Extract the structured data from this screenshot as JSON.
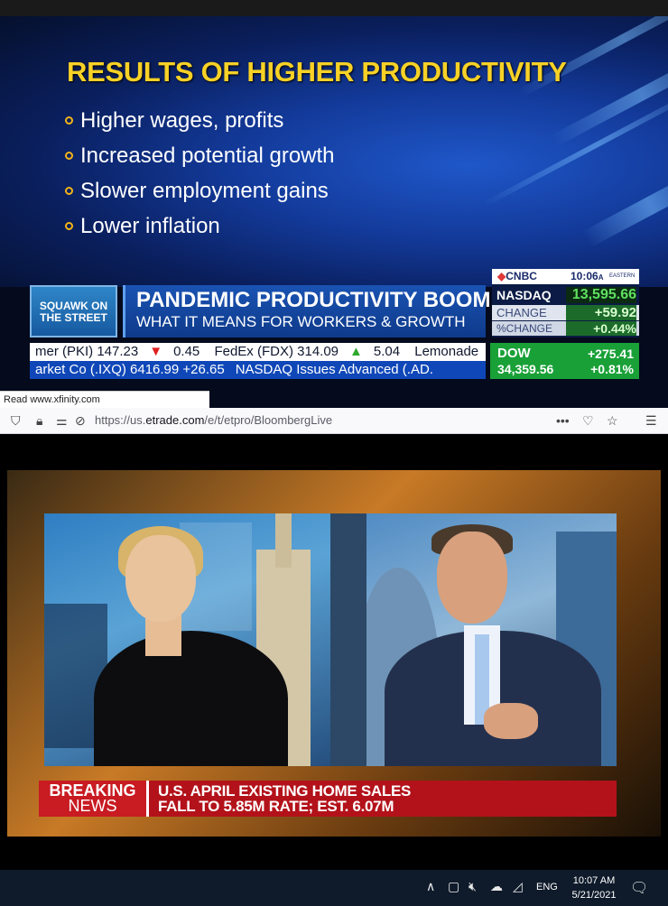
{
  "cnbc": {
    "slide_title": "RESULTS OF HIGHER PRODUCTIVITY",
    "bullets": [
      "Higher wages, profits",
      "Increased potential growth",
      "Slower employment gains",
      "Lower inflation"
    ],
    "show_logo_line1": "SQUAWK ON",
    "show_logo_line2": "THE STREET",
    "headline": "PANDEMIC PRODUCTIVITY BOOM",
    "subheadline": "WHAT IT MEANS FOR WORKERS & GROWTH",
    "network": "CNBC",
    "clock": "10:06",
    "clock_suffix": "A",
    "timezone": "EASTERN",
    "nasdaq_label": "NASDAQ",
    "nasdaq_value": "13,595.66",
    "change_label": "CHANGE",
    "change_value": "+59.92",
    "pct_change_label": "%CHANGE",
    "pct_change_value": "+0.44%",
    "ticker1": {
      "a": "mer (PKI) 147.23",
      "a_arrow": "▼",
      "a_chg": "0.45",
      "b": "FedEx (FDX) 314.09",
      "b_arrow": "▲",
      "b_chg": "5.04",
      "c": "Lemonade"
    },
    "ticker2": {
      "a": "arket Co (.IXQ) 6416.99 +26.65",
      "b": "NASDAQ  Issues Advanced (.AD."
    },
    "dow_label": "DOW",
    "dow_value": "34,359.56",
    "dow_change": "+275.41",
    "dow_pct": "+0.81%",
    "status_text": "Read www.xfinity.com"
  },
  "browser": {
    "url_prefix": "https://us.",
    "url_domain": "etrade.com",
    "url_path": "/e/t/etpro/BloombergLive",
    "icons": [
      "shield-icon",
      "lock-icon",
      "permissions-icon",
      "autoplay-blocked-icon",
      "more-icon",
      "pocket-icon",
      "bookmark-star-icon",
      "menu-icon"
    ]
  },
  "bloomberg": {
    "breaking_line1": "BREAKING",
    "breaking_line2": "NEWS",
    "story_line1": "U.S. APRIL EXISTING HOME SALES",
    "story_line2": "FALL TO 5.85M RATE; EST. 6.07M"
  },
  "taskbar": {
    "lang": "ENG",
    "time": "10:07 AM",
    "date": "5/21/2021",
    "icons": [
      "chevron-up-icon",
      "meet-now-icon",
      "speaker-muted-icon",
      "onedrive-icon",
      "wifi-icon",
      "notifications-icon"
    ]
  },
  "colors": {
    "slide_title": "#f7d126",
    "cnbc_green": "#19a037",
    "breaking_red": "#b3121a",
    "taskbar": "#0f1b2b"
  }
}
